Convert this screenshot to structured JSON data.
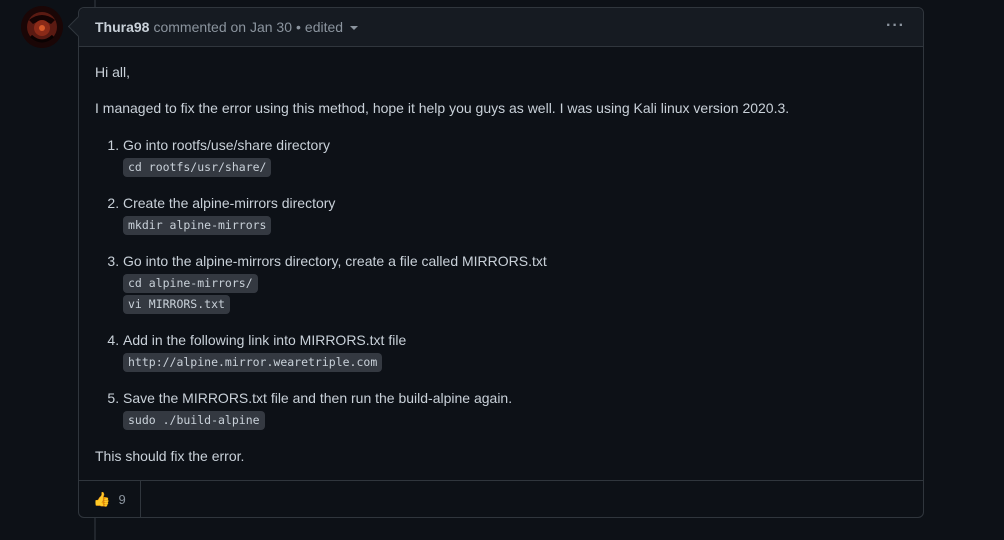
{
  "comment": {
    "author": "Thura98",
    "action": "commented on Jan 30",
    "separator": "•",
    "edited_label": "edited",
    "menu_label": "···"
  },
  "body": {
    "greeting": "Hi all,",
    "intro": "I managed to fix the error using this method, hope it help you guys as well. I was using Kali linux version 2020.3.",
    "steps": [
      {
        "text": "Go into rootfs/use/share directory",
        "code": [
          "cd rootfs/usr/share/"
        ]
      },
      {
        "text": "Create the alpine-mirrors directory",
        "code": [
          "mkdir alpine-mirrors"
        ]
      },
      {
        "text": "Go into the alpine-mirrors directory, create a file called MIRRORS.txt",
        "code": [
          "cd alpine-mirrors/",
          "vi MIRRORS.txt"
        ]
      },
      {
        "text": "Add in the following link into MIRRORS.txt file",
        "code": [
          "http://alpine.mirror.wearetriple.com"
        ]
      },
      {
        "text": "Save the MIRRORS.txt file and then run the build-alpine again.",
        "code": [
          "sudo ./build-alpine"
        ]
      }
    ],
    "closing": "This should fix the error."
  },
  "reactions": [
    {
      "icon": "thumbs-up-icon",
      "emoji": "👍",
      "count": "9"
    }
  ]
}
